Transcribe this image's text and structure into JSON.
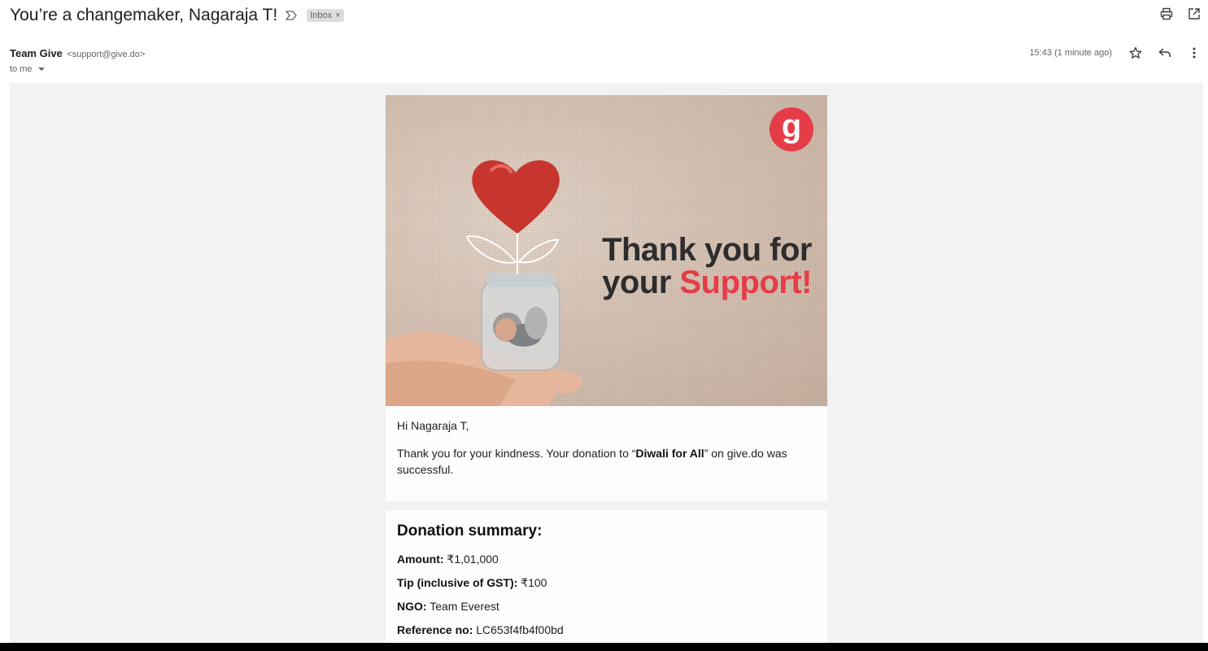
{
  "email": {
    "subject": "You’re a changemaker, Nagaraja T!",
    "label": "Inbox",
    "label_close": "×",
    "sender_name": "Team Give",
    "sender_email": "<support@give.do>",
    "recipient": "to me",
    "timestamp": "15:43 (1 minute ago)"
  },
  "hero": {
    "logo_letter": "g",
    "headline_line1": "Thank you for",
    "headline_line2_dark": "your ",
    "headline_line2_accent": "Support!"
  },
  "body": {
    "greeting": "Hi Nagaraja T,",
    "thanks_prefix": "Thank you for your kindness. Your donation to “",
    "campaign": "Diwali for All",
    "thanks_suffix": "” on give.do was successful."
  },
  "summary": {
    "title": "Donation summary:",
    "rows": [
      {
        "label": "Amount:",
        "value": " ₹1,01,000"
      },
      {
        "label": "Tip (inclusive of GST):",
        "value": " ₹100"
      },
      {
        "label": "NGO:",
        "value": " Team Everest"
      },
      {
        "label": "Reference no:",
        "value": " LC653f4fb4f00bd"
      }
    ]
  },
  "icons": {
    "print": "print-icon",
    "open_new_window": "open-in-new-window-icon",
    "star": "star-icon",
    "reply": "reply-icon",
    "more": "more-vertical-icon",
    "important": "important-marker-icon"
  },
  "colors": {
    "accent": "#e43d47",
    "canvas": "#f2f2f2",
    "headline": "#2d2d2d"
  }
}
